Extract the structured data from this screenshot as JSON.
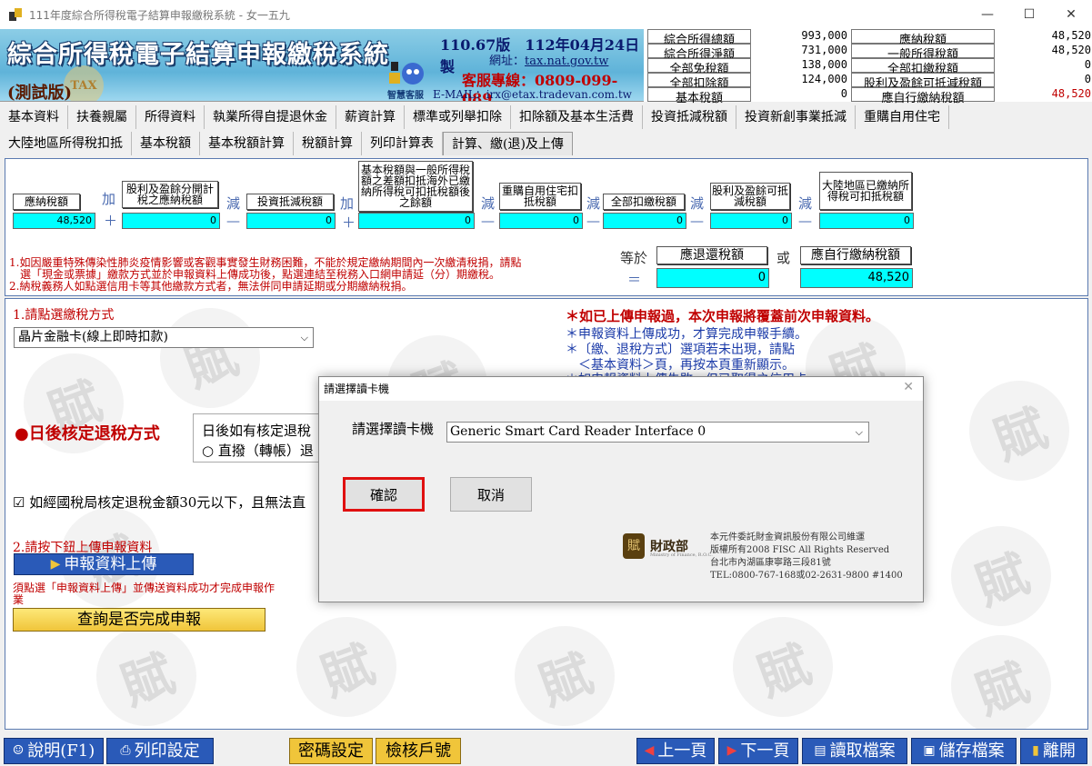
{
  "window": {
    "title": "111年度綜合所得稅電子結算申報繳稅系統 - 女一五九",
    "minimize": "—",
    "maximize": "☐",
    "close": "✕"
  },
  "banner": {
    "title": "綜合所得稅電子結算申報繳稅系統",
    "trial": "(測試版)",
    "version": "110.67版　112年04月24日製",
    "website_label": "網址：",
    "website": "tax.nat.gov.tw",
    "hotline": "客服專線：0809-099-089",
    "email": "E-MAIL：irx@etax.tradevan.com.tw",
    "coin": "TAX",
    "robot_label": "智慧客服"
  },
  "summary": {
    "left": [
      {
        "label": "綜合所得總額",
        "value": "993,000"
      },
      {
        "label": "綜合所得淨額",
        "value": "731,000"
      },
      {
        "label": "全部免稅額",
        "value": "138,000"
      },
      {
        "label": "全部扣除額",
        "value": "124,000"
      },
      {
        "label": "基本稅額",
        "value": "0"
      }
    ],
    "right": [
      {
        "label": "應納稅額",
        "value": "48,520"
      },
      {
        "label": "一般所得稅額",
        "value": "48,520"
      },
      {
        "label": "全部扣繳稅額",
        "value": "0"
      },
      {
        "label": "股利及盈餘可抵減稅額",
        "value": "0"
      },
      {
        "label": "應自行繳納稅額",
        "value": "48,520"
      }
    ]
  },
  "tabs_row1": [
    "基本資料",
    "扶養親屬",
    "所得資料",
    "執業所得自提退休金",
    "薪資計算",
    "標準或列舉扣除",
    "扣除額及基本生活費",
    "投資抵減稅額",
    "投資新創事業抵減",
    "重購自用住宅"
  ],
  "tabs_row2": [
    "大陸地區所得稅扣抵",
    "基本稅額",
    "基本稅額計算",
    "稅額計算",
    "列印計算表",
    "計算、繳(退)及上傳"
  ],
  "formula": {
    "boxes": [
      {
        "label": "應納稅額",
        "value": "48,520"
      },
      {
        "label": "股利及盈餘分開計稅之應納稅額",
        "value": "0"
      },
      {
        "label": "投資抵減稅額",
        "value": "0"
      },
      {
        "label": "基本稅額與一般所得稅額之差額扣抵海外已繳納所得稅可扣抵稅額後之餘額",
        "value": "0"
      },
      {
        "label": "重購自用住宅扣抵稅額",
        "value": "0"
      },
      {
        "label": "全部扣繳稅額",
        "value": "0"
      },
      {
        "label": "股利及盈餘可抵減稅額",
        "value": "0"
      },
      {
        "label": "大陸地區已繳納所得稅可扣抵稅額",
        "value": "0"
      }
    ],
    "ops": [
      "加",
      "＋",
      "減",
      "—",
      "加",
      "＋",
      "減",
      "—",
      "減",
      "—",
      "減",
      "—",
      "減",
      "—"
    ],
    "equals_label": "等於",
    "equals_sign": "＝",
    "or_label": "或",
    "refund_label": "應退還稅額",
    "refund_value": "0",
    "pay_label": "應自行繳納稅額",
    "pay_value": "48,520",
    "note1": "1.如因嚴重特殊傳染性肺炎疫情影響或客觀事實發生財務困難，不能於規定繳納期間內一次繳清稅捐，請點",
    "note1b": "　選「現金或票據」繳款方式並於申報資料上傳成功後，點選連結至稅務入口網申請延（分）期繳稅。",
    "note2": "2.納稅義務人如點選信用卡等其他繳款方式者，無法併同申請延期或分期繳納稅捐。"
  },
  "lower": {
    "step1_label": "1.請點選繳稅方式",
    "pay_method": "晶片金融卡(線上即時扣款)",
    "warn_title": "＊如已上傳申報過，本次申報將覆蓋前次申報資料。",
    "warn_1": "＊申報資料上傳成功，才算完成申報手續。",
    "warn_2": "＊〔繳、退稅方式〕選項若未出現，請點",
    "warn_3": "　＜基本資料＞頁，再按本頁重新顯示。",
    "warn_4": "＊如申報資料上傳失敗，但已取得之信用卡",
    "refund_title": "●日後核定退稅方式",
    "refund_q": "日後如有核定退稅",
    "refund_opt": "○ 直撥（轉帳）退",
    "check_text": "☑ 如經國稅局核定退稅金額30元以下，且無法直",
    "step2_label": "2.請按下鈕上傳申報資料",
    "upload_btn": "申報資料上傳",
    "upload_note": "須點選「申報資料上傳」並傳送資料成功才完成申報作業",
    "query_btn": "查詢是否完成申報"
  },
  "bottom": {
    "help": "說明(F1)",
    "print_setup": "列印設定",
    "password": "密碼設定",
    "verify": "檢核戶號",
    "prev": "上一頁",
    "next": "下一頁",
    "load": "讀取檔案",
    "save": "儲存檔案",
    "exit": "離開"
  },
  "dialog": {
    "title": "請選擇讀卡機",
    "close": "✕",
    "label": "請選擇讀卡機",
    "reader": "Generic Smart Card Reader Interface 0",
    "ok": "確認",
    "cancel": "取消",
    "seal_text": "財政部",
    "seal_sub": "Ministry of Finance, R.O.C.",
    "credit_1": "本元件委託財金資訊股份有限公司維運",
    "credit_2": "版權所有2008 FISC All Rights Reserved",
    "credit_3": "台北市內湖區康寧路三段81號",
    "credit_4": "TEL:0800-767-168或02-2631-9800 #1400"
  },
  "colors": {
    "cyan": "#00ffff",
    "red": "#c00000",
    "blue_btn": "#2a5ab8",
    "yellow_btn": "#f0c53a"
  }
}
